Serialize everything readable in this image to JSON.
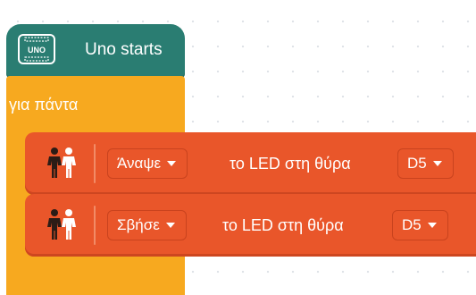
{
  "hat_block": {
    "icon_text": "UNO",
    "label": "Uno starts",
    "color": "#2a7d72"
  },
  "loop_block": {
    "label": "για πάντα",
    "color": "#f7a91f"
  },
  "commands": [
    {
      "icon": "people-led-icon",
      "action": "Άναψε",
      "text": "το LED στη θύρα",
      "port": "D5",
      "color": "#e9562a"
    },
    {
      "icon": "people-led-icon",
      "action": "Σβήσε",
      "text": "το LED στη θύρα",
      "port": "D5",
      "color": "#e9562a"
    }
  ]
}
